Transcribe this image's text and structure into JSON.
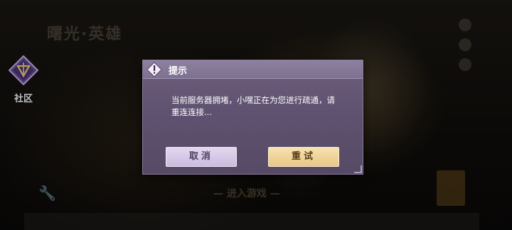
{
  "background": {
    "title": "曙光·英雄",
    "enter_button": "— 进入游戏 —"
  },
  "community": {
    "label": "社区",
    "icon": "community-diamond-icon"
  },
  "dialog": {
    "title": "提示",
    "message": "当前服务器拥堵，小嘿正在为您进行疏通，请重连连接...",
    "cancel_label": "取消",
    "retry_label": "重试"
  },
  "colors": {
    "dialog_body": "#5f5270",
    "dialog_header": "#8e81a0",
    "cancel_button": "#d6c9e6",
    "retry_button": "#f0d59a"
  }
}
